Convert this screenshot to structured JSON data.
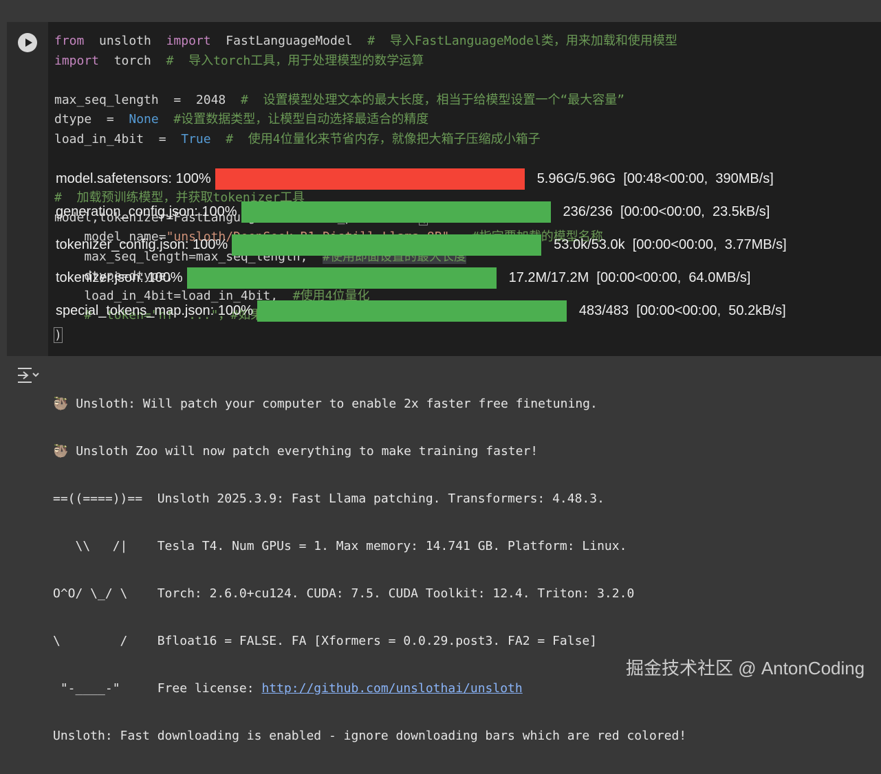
{
  "code_lines": [
    [
      {
        "t": "from",
        "c": "kw"
      },
      {
        "t": "  unsloth  ",
        "c": ""
      },
      {
        "t": "import",
        "c": "kw"
      },
      {
        "t": "  FastLanguageModel  ",
        "c": ""
      },
      {
        "t": "#  导入FastLanguageModel类，用来加载和使用模型",
        "c": "cm"
      }
    ],
    [
      {
        "t": "import",
        "c": "kw"
      },
      {
        "t": "  torch  ",
        "c": ""
      },
      {
        "t": "#  导入torch工具，用于处理模型的数学运算",
        "c": "cm"
      }
    ],
    [],
    [
      {
        "t": "max_seq_length  =  2048  ",
        "c": ""
      },
      {
        "t": "#  设置模型处理文本的最大长度，相当于给模型设置一个“最大容量”",
        "c": "cm"
      }
    ],
    [
      {
        "t": "dtype  =  ",
        "c": ""
      },
      {
        "t": "None",
        "c": "bool"
      },
      {
        "t": "  ",
        "c": ""
      },
      {
        "t": "#设置数据类型，让模型自动选择最适合的精度",
        "c": "cm"
      }
    ],
    [
      {
        "t": "load_in_4bit  =  ",
        "c": ""
      },
      {
        "t": "True",
        "c": "bool"
      },
      {
        "t": "  ",
        "c": ""
      },
      {
        "t": "#  使用4位量化来节省内存，就像把大箱子压缩成小箱子",
        "c": "cm"
      }
    ],
    [],
    [],
    [
      {
        "t": "#  加载预训练模型，并获取tokenizer工具",
        "c": "cm"
      }
    ],
    [
      {
        "t": "model,tokenizer=FastLanguageModel.from_pretrained",
        "c": ""
      },
      {
        "t": "(",
        "c": "br"
      }
    ],
    [
      {
        "t": "    model_name=",
        "c": ""
      },
      {
        "t": "\"unsloth/DeepSeek-R1-Distill-Llama-8B\"",
        "c": "str"
      },
      {
        "t": ",  ",
        "c": ""
      },
      {
        "t": "#指定要加载的模型名称",
        "c": "cm"
      }
    ],
    [
      {
        "t": "    max_seq_length=max_seq_length,  ",
        "c": ""
      },
      {
        "t": "#使用即面设置的最大长度",
        "c": "cm sel"
      }
    ],
    [
      {
        "t": "    dtype=dtype,  ",
        "c": ""
      },
      {
        "t": "#使用前面设置的数据类型",
        "c": "cm"
      }
    ],
    [
      {
        "t": "    load_in_4bit=load_in_4bit,  ",
        "c": ""
      },
      {
        "t": "#使用4位量化",
        "c": "cm"
      }
    ],
    [
      {
        "t": "    #  token=\"hf  ...\"，#如果需要访问授权模型，可以在这里填入密钥",
        "c": "cm"
      }
    ],
    [
      {
        "t": ")",
        "c": "br"
      }
    ]
  ],
  "output": {
    "line1": "🦥 Unsloth: Will patch your computer to enable 2x faster free finetuning.",
    "line2": "🦥 Unsloth Zoo will now patch everything to make training faster!",
    "line3": "==((====))==  Unsloth 2025.3.9: Fast Llama patching. Transformers: 4.48.3.",
    "line4": "   \\\\   /|    Tesla T4. Num GPUs = 1. Max memory: 14.741 GB. Platform: Linux.",
    "line5": "O^O/ \\_/ \\    Torch: 2.6.0+cu124. CUDA: 7.5. CUDA Toolkit: 12.4. Triton: 3.2.0",
    "line6": "\\        /    Bfloat16 = FALSE. FA [Xformers = 0.0.29.post3. FA2 = False]",
    "line7_prefix": " \"-____-\"     Free license: ",
    "license_link": "http://github.com/unslothai/unsloth",
    "line8": "Unsloth: Fast downloading is enabled - ignore downloading bars which are red colored!"
  },
  "downloads": [
    {
      "name": "model.safetensors:",
      "pct": "100%",
      "progress": 1.0,
      "color": "#f44336",
      "stats": "5.96G/5.96G  [00:48<00:00,  390MB/s]"
    },
    {
      "name": "generation_config.json:",
      "pct": "100%",
      "progress": 1.0,
      "color": "#4caf50",
      "stats": "236/236  [00:00<00:00,  23.5kB/s]"
    },
    {
      "name": "tokenizer_config.json:",
      "pct": "100%",
      "progress": 1.0,
      "color": "#4caf50",
      "stats": "53.0k/53.0k  [00:00<00:00,  3.77MB/s]"
    },
    {
      "name": "tokenizer.json:",
      "pct": "100%",
      "progress": 1.0,
      "color": "#4caf50",
      "stats": "17.2M/17.2M  [00:00<00:00,  64.0MB/s]"
    },
    {
      "name": "special_tokens_map.json:",
      "pct": "100%",
      "progress": 1.0,
      "color": "#4caf50",
      "stats": "483/483  [00:00<00:00,  50.2kB/s]"
    }
  ],
  "watermark": "掘金技术社区 @ AntonCoding",
  "icons": {
    "run": "play-icon",
    "output": "output-toggle-icon"
  }
}
